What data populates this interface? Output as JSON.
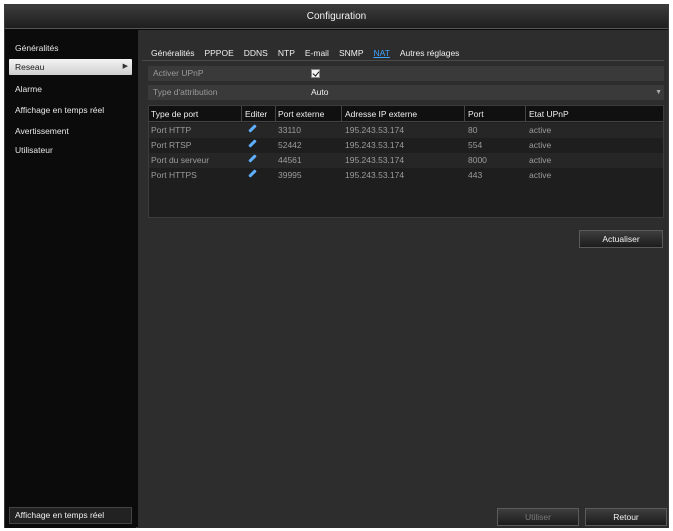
{
  "window": {
    "title": "Configuration"
  },
  "sidebar": {
    "items": [
      {
        "label": "Généralités"
      },
      {
        "label": "Reseau",
        "active": true
      },
      {
        "label": "Alarme"
      },
      {
        "label": "Affichage en temps réel"
      },
      {
        "label": "Avertissement"
      },
      {
        "label": "Utilisateur"
      }
    ],
    "bottom_label": "Affichage en temps réel"
  },
  "tabs": [
    {
      "label": "Généralités"
    },
    {
      "label": "PPPOE"
    },
    {
      "label": "DDNS"
    },
    {
      "label": "NTP"
    },
    {
      "label": "E-mail"
    },
    {
      "label": "SNMP"
    },
    {
      "label": "NAT",
      "active": true
    },
    {
      "label": "Autres réglages"
    }
  ],
  "form": {
    "upnp_label": "Activer UPnP",
    "upnp_checked": true,
    "type_label": "Type d'attribution",
    "type_value": "Auto"
  },
  "table": {
    "headers": [
      "Type de port",
      "Editer",
      "Port externe",
      "Adresse IP externe",
      "Port",
      "Etat UPnP"
    ],
    "rows": [
      {
        "type": "Port HTTP",
        "ext_port": "33110",
        "ext_ip": "195.243.53.174",
        "port": "80",
        "state": "active"
      },
      {
        "type": "Port RTSP",
        "ext_port": "52442",
        "ext_ip": "195.243.53.174",
        "port": "554",
        "state": "active"
      },
      {
        "type": "Port du serveur",
        "ext_port": "44561",
        "ext_ip": "195.243.53.174",
        "port": "8000",
        "state": "active"
      },
      {
        "type": "Port HTTPS",
        "ext_port": "39995",
        "ext_ip": "195.243.53.174",
        "port": "443",
        "state": "active"
      }
    ],
    "edit_icon": "pencil-icon"
  },
  "buttons": {
    "refresh": "Actualiser",
    "apply": "Utiliser",
    "back": "Retour"
  },
  "colors": {
    "accent": "#3fa4ff",
    "background": "#2d2d2d",
    "sidebar": "#0b0b0b"
  }
}
